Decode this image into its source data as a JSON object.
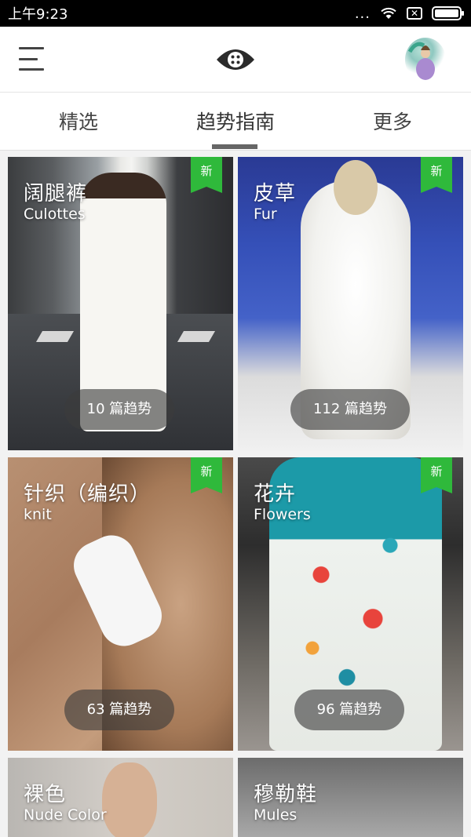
{
  "status_bar": {
    "time": "上午9:23",
    "dots": "...",
    "sim_label": "✕"
  },
  "app_bar": {
    "menu_icon": "hamburger-icon",
    "logo_icon": "eye-logo-icon",
    "avatar_icon": "user-avatar"
  },
  "tabs": [
    {
      "label": "精选",
      "active": false
    },
    {
      "label": "趋势指南",
      "active": true
    },
    {
      "label": "更多",
      "active": false
    }
  ],
  "cards": [
    {
      "title": "阔腿裤",
      "subtitle": "Culottes",
      "badge": "新",
      "count": "10 篇趋势"
    },
    {
      "title": "皮草",
      "subtitle": "Fur",
      "badge": "新",
      "count": "112 篇趋势"
    },
    {
      "title": "针织（编织）",
      "subtitle": "knit",
      "badge": "新",
      "count": "63 篇趋势"
    },
    {
      "title": "花卉",
      "subtitle": "Flowers",
      "badge": "新",
      "count": "96 篇趋势"
    },
    {
      "title": "裸色",
      "subtitle": "Nude Color"
    },
    {
      "title": "穆勒鞋",
      "subtitle": "Mules"
    }
  ],
  "colors": {
    "badge_green": "#2fb93b",
    "tab_indicator": "#666666",
    "status_bar": "#000000"
  }
}
